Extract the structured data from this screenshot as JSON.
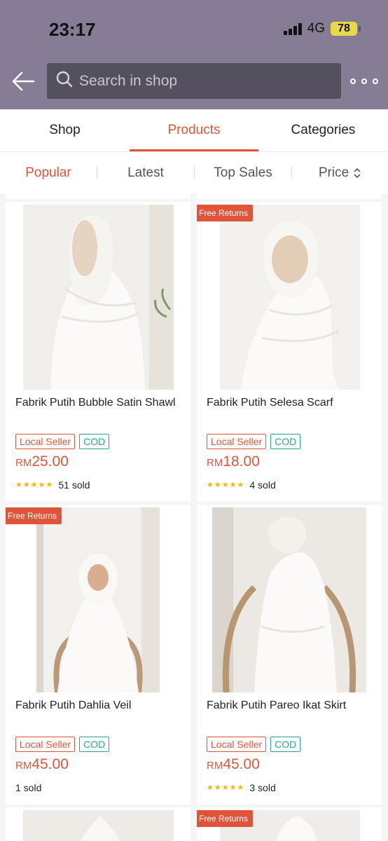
{
  "status": {
    "time": "23:17",
    "network": "4G",
    "battery": "78"
  },
  "search": {
    "placeholder": "Search in shop"
  },
  "tabs": [
    {
      "label": "Shop"
    },
    {
      "label": "Products"
    },
    {
      "label": "Categories"
    }
  ],
  "filters": [
    {
      "label": "Popular"
    },
    {
      "label": "Latest"
    },
    {
      "label": "Top Sales"
    },
    {
      "label": "Price"
    }
  ],
  "products": [
    {
      "name": "Fabrik Putih Bubble Satin Shawl",
      "badge": "",
      "tags": [
        "Local Seller",
        "COD"
      ],
      "currency": "RM",
      "price": "25.00",
      "rating": 5,
      "sold": "51 sold"
    },
    {
      "name": "Fabrik Putih Selesa Scarf",
      "badge": "Free Returns",
      "tags": [
        "Local Seller",
        "COD"
      ],
      "currency": "RM",
      "price": "18.00",
      "rating": 5,
      "sold": "4 sold"
    },
    {
      "name": "Fabrik Putih Dahlia Veil",
      "badge": "Free Returns",
      "tags": [
        "Local Seller",
        "COD"
      ],
      "currency": "RM",
      "price": "45.00",
      "rating": 0,
      "sold": "1 sold"
    },
    {
      "name": "Fabrik Putih Pareo Ikat Skirt",
      "badge": "",
      "tags": [
        "Local Seller",
        "COD"
      ],
      "currency": "RM",
      "price": "45.00",
      "rating": 5,
      "sold": "3 sold"
    }
  ],
  "next_row": {
    "badge": "Free Returns"
  },
  "colors": {
    "accent": "#e0553a",
    "header": "#877c95",
    "cod": "#26a69a",
    "star": "#f5b800"
  }
}
